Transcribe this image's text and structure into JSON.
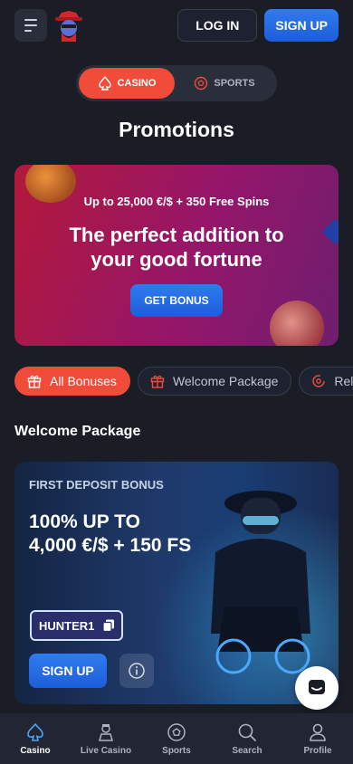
{
  "header": {
    "login_label": "LOG IN",
    "signup_label": "SIGN UP"
  },
  "toggle": {
    "casino_label": "CASINO",
    "sports_label": "SPORTS"
  },
  "page_title": "Promotions",
  "banner": {
    "subtitle": "Up to 25,000 €/$ + 350 Free Spins",
    "headline_line1": "The perfect addition to",
    "headline_line2": "your good fortune",
    "button_label": "GET BONUS"
  },
  "filters": [
    {
      "label": "All Bonuses",
      "icon": "gift-icon",
      "active": true
    },
    {
      "label": "Welcome Package",
      "icon": "gift-icon",
      "active": false
    },
    {
      "label": "Rel",
      "icon": "reload-icon",
      "active": false
    }
  ],
  "section_title": "Welcome Package",
  "welcome_card": {
    "kicker": "FIRST DEPOSIT BONUS",
    "headline_line1": "100% UP TO",
    "headline_line2": "4,000 €/$ + 150 FS",
    "promo_code": "HUNTER1",
    "signup_label": "SIGN UP"
  },
  "bottom_nav": [
    {
      "label": "Casino",
      "icon": "spade-icon",
      "active": true
    },
    {
      "label": "Live Casino",
      "icon": "dealer-icon",
      "active": false
    },
    {
      "label": "Sports",
      "icon": "soccer-ball-icon",
      "active": false
    },
    {
      "label": "Search",
      "icon": "search-icon",
      "active": false
    },
    {
      "label": "Profile",
      "icon": "user-icon",
      "active": false
    }
  ],
  "colors": {
    "accent": "#f14c3a",
    "primary": "#2f7bf0",
    "background": "#1a1d26"
  }
}
